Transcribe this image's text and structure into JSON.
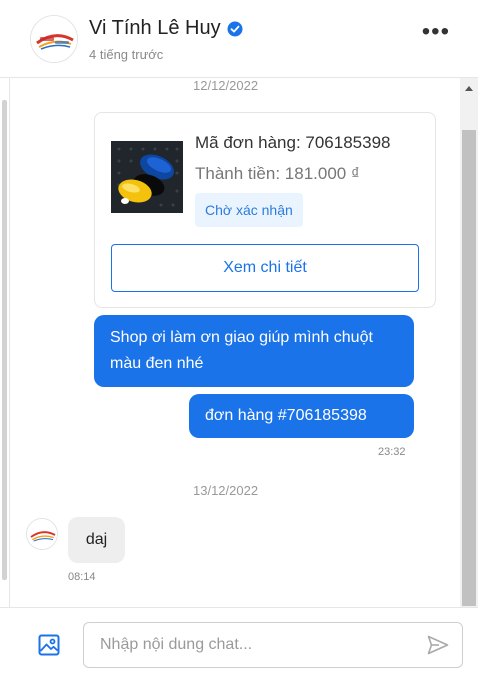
{
  "header": {
    "shop_name": "Vi Tính Lê Huy",
    "last_seen": "4 tiếng trước",
    "more_label": "•••",
    "verified_icon": "verified-check-icon",
    "accent": "#1a73e8"
  },
  "thread": {
    "date_1": "12/12/2022",
    "order": {
      "id_text": "Mã đơn hàng: 706185398",
      "total_text": "Thành tiền: 181.000 ₫",
      "status": "Chờ xác nhận",
      "detail_button": "Xem chi tiết"
    },
    "outgoing": [
      {
        "text": "Shop ơi làm ơn giao giúp mình chuột màu đen nhé"
      },
      {
        "text": "đơn hàng #706185398"
      }
    ],
    "outgoing_time": "23:32",
    "date_2": "13/12/2022",
    "incoming": {
      "text": "daj",
      "time": "08:14"
    }
  },
  "composer": {
    "placeholder": "Nhập nội dung chat...",
    "value": "",
    "image_icon": "image-upload-icon",
    "send_icon": "send-icon"
  },
  "colors": {
    "bubble_out": "#1a73e8",
    "bubble_in": "#eeeeee",
    "status_bg": "#eaf4fe"
  }
}
